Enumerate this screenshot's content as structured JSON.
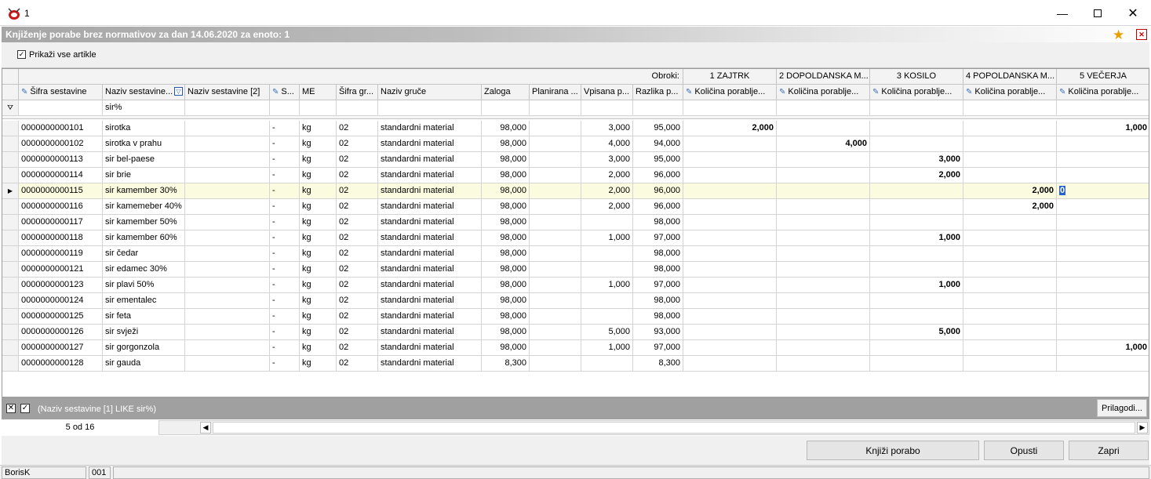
{
  "window": {
    "title": "1",
    "min_icon": "minimize-icon",
    "max_icon": "maximize-icon",
    "close_icon": "close-icon"
  },
  "header": {
    "title": "Knjiženje porabe brez normativov za dan 14.06.2020 za enoto: 1"
  },
  "toolbar": {
    "show_all_label": "Prikaži vse artikle",
    "show_all_checked": true
  },
  "grid": {
    "band_label": "Obroki:",
    "meals": [
      "1 ZAJTRK",
      "2 DOPOLDANSKA M...",
      "3 KOSILO",
      "4 POPOLDANSKA M...",
      "5 VEČERJA"
    ],
    "columns": [
      "Šifra sestavine",
      "Naziv sestavine...",
      "Naziv sestavine [2]",
      "S...",
      "ME",
      "Šifra gr...",
      "Naziv gruče",
      "Zaloga",
      "Planirana ...",
      "Vpisana p...",
      "Razlika p..."
    ],
    "meal_column_label": "Količina porablje...",
    "filter_value": "sir%",
    "rows": [
      {
        "code": "0000000000101",
        "name": "sirotka",
        "s": "-",
        "me": "kg",
        "grp": "02",
        "grp_name": "standardni material",
        "stock": "98,000",
        "plan": "",
        "entered": "3,000",
        "diff": "95,000",
        "m1": "2,000",
        "m2": "",
        "m3": "",
        "m4": "",
        "m5": "1,000"
      },
      {
        "code": "0000000000102",
        "name": "sirotka v prahu",
        "s": "-",
        "me": "kg",
        "grp": "02",
        "grp_name": "standardni material",
        "stock": "98,000",
        "plan": "",
        "entered": "4,000",
        "diff": "94,000",
        "m1": "",
        "m2": "4,000",
        "m3": "",
        "m4": "",
        "m5": ""
      },
      {
        "code": "0000000000113",
        "name": "sir  bel-paese",
        "s": "-",
        "me": "kg",
        "grp": "02",
        "grp_name": "standardni material",
        "stock": "98,000",
        "plan": "",
        "entered": "3,000",
        "diff": "95,000",
        "m1": "",
        "m2": "",
        "m3": "3,000",
        "m4": "",
        "m5": ""
      },
      {
        "code": "0000000000114",
        "name": "sir brie",
        "s": "-",
        "me": "kg",
        "grp": "02",
        "grp_name": "standardni material",
        "stock": "98,000",
        "plan": "",
        "entered": "2,000",
        "diff": "96,000",
        "m1": "",
        "m2": "",
        "m3": "2,000",
        "m4": "",
        "m5": ""
      },
      {
        "code": "0000000000115",
        "name": "sir kamember 30%",
        "s": "-",
        "me": "kg",
        "grp": "02",
        "grp_name": "standardni material",
        "stock": "98,000",
        "plan": "",
        "entered": "2,000",
        "diff": "96,000",
        "m1": "",
        "m2": "",
        "m3": "",
        "m4": "2,000",
        "m5": "0"
      },
      {
        "code": "0000000000116",
        "name": "sir kamemeber 40%",
        "s": "-",
        "me": "kg",
        "grp": "02",
        "grp_name": "standardni material",
        "stock": "98,000",
        "plan": "",
        "entered": "2,000",
        "diff": "96,000",
        "m1": "",
        "m2": "",
        "m3": "",
        "m4": "2,000",
        "m5": ""
      },
      {
        "code": "0000000000117",
        "name": "sir kamember 50%",
        "s": "-",
        "me": "kg",
        "grp": "02",
        "grp_name": "standardni material",
        "stock": "98,000",
        "plan": "",
        "entered": "",
        "diff": "98,000",
        "m1": "",
        "m2": "",
        "m3": "",
        "m4": "",
        "m5": ""
      },
      {
        "code": "0000000000118",
        "name": "sir kamember 60%",
        "s": "-",
        "me": "kg",
        "grp": "02",
        "grp_name": "standardni material",
        "stock": "98,000",
        "plan": "",
        "entered": "1,000",
        "diff": "97,000",
        "m1": "",
        "m2": "",
        "m3": "1,000",
        "m4": "",
        "m5": ""
      },
      {
        "code": "0000000000119",
        "name": "sir čedar",
        "s": "-",
        "me": "kg",
        "grp": "02",
        "grp_name": "standardni material",
        "stock": "98,000",
        "plan": "",
        "entered": "",
        "diff": "98,000",
        "m1": "",
        "m2": "",
        "m3": "",
        "m4": "",
        "m5": ""
      },
      {
        "code": "0000000000121",
        "name": "sir edamec 30%",
        "s": "-",
        "me": "kg",
        "grp": "02",
        "grp_name": "standardni material",
        "stock": "98,000",
        "plan": "",
        "entered": "",
        "diff": "98,000",
        "m1": "",
        "m2": "",
        "m3": "",
        "m4": "",
        "m5": ""
      },
      {
        "code": "0000000000123",
        "name": "sir plavi  50%",
        "s": "-",
        "me": "kg",
        "grp": "02",
        "grp_name": "standardni material",
        "stock": "98,000",
        "plan": "",
        "entered": "1,000",
        "diff": "97,000",
        "m1": "",
        "m2": "",
        "m3": "1,000",
        "m4": "",
        "m5": ""
      },
      {
        "code": "0000000000124",
        "name": "sir ementalec",
        "s": "-",
        "me": "kg",
        "grp": "02",
        "grp_name": "standardni material",
        "stock": "98,000",
        "plan": "",
        "entered": "",
        "diff": "98,000",
        "m1": "",
        "m2": "",
        "m3": "",
        "m4": "",
        "m5": ""
      },
      {
        "code": "0000000000125",
        "name": "sir feta",
        "s": "-",
        "me": "kg",
        "grp": "02",
        "grp_name": "standardni material",
        "stock": "98,000",
        "plan": "",
        "entered": "",
        "diff": "98,000",
        "m1": "",
        "m2": "",
        "m3": "",
        "m4": "",
        "m5": ""
      },
      {
        "code": "0000000000126",
        "name": "sir svježi",
        "s": "-",
        "me": "kg",
        "grp": "02",
        "grp_name": "standardni material",
        "stock": "98,000",
        "plan": "",
        "entered": "5,000",
        "diff": "93,000",
        "m1": "",
        "m2": "",
        "m3": "5,000",
        "m4": "",
        "m5": ""
      },
      {
        "code": "0000000000127",
        "name": "sir  gorgonzola",
        "s": "-",
        "me": "kg",
        "grp": "02",
        "grp_name": "standardni material",
        "stock": "98,000",
        "plan": "",
        "entered": "1,000",
        "diff": "97,000",
        "m1": "",
        "m2": "",
        "m3": "",
        "m4": "",
        "m5": "1,000"
      },
      {
        "code": "0000000000128",
        "name": "sir gauda",
        "s": "-",
        "me": "kg",
        "grp": "02",
        "grp_name": "standardni material",
        "stock": "8,300",
        "plan": "",
        "entered": "",
        "diff": "8,300",
        "m1": "",
        "m2": "",
        "m3": "",
        "m4": "",
        "m5": ""
      }
    ],
    "selected_row": 4
  },
  "filter_bar": {
    "expression": "(Naziv sestavine [1] LIKE sir%)",
    "customize_label": "Prilagodi..."
  },
  "record_count": "5 od 16",
  "buttons": {
    "post": "Knjiži porabo",
    "cancel": "Opusti",
    "close": "Zapri"
  },
  "statusbar": {
    "user": "BorisK",
    "code": "001"
  }
}
